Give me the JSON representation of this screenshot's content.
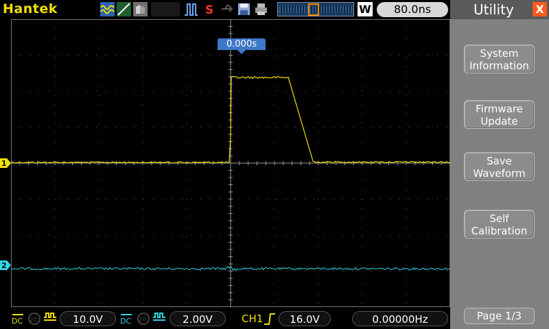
{
  "brand": "Hantek",
  "timebase": "80.0ns",
  "window_button": "W",
  "trigger_position": "0.000s",
  "channels": {
    "ch1": {
      "marker": "1",
      "color": "#f0e000",
      "volts_div": "10.0V"
    },
    "ch2": {
      "marker": "2",
      "color": "#2fd8e6",
      "volts_div": "2.00V"
    }
  },
  "trigger": {
    "source": "CH1",
    "level": "16.0V"
  },
  "frequency": "0.00000Hz",
  "menu": {
    "title": "Utility",
    "close": "X",
    "buttons": [
      {
        "line1": "System",
        "line2": "Information"
      },
      {
        "line1": "Firmware",
        "line2": "Update"
      },
      {
        "line1": "Save",
        "line2": "Waveform"
      },
      {
        "line1": "Self",
        "line2": "Calibration"
      }
    ],
    "page": "Page 1/3"
  },
  "icons": [
    "wave-mode-icon",
    "ramp-icon",
    "persist-icon",
    "run-stop-icon",
    "record-icon",
    "save-icon",
    "print-icon",
    "coupling-dc-icon",
    "bw-limit-icon",
    "rising-edge-icon"
  ]
}
